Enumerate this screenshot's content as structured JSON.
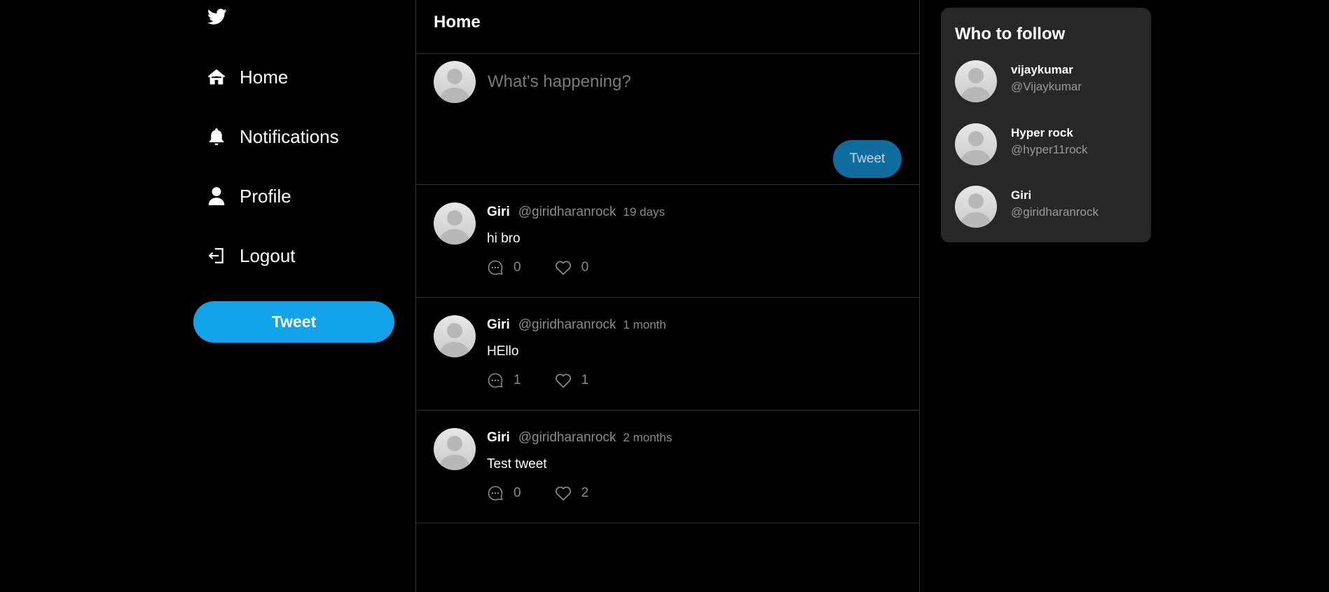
{
  "sidebar": {
    "logo_icon": "twitter-bird-icon",
    "items": [
      {
        "label": "Home",
        "icon": "home-icon"
      },
      {
        "label": "Notifications",
        "icon": "bell-icon"
      },
      {
        "label": "Profile",
        "icon": "user-icon"
      },
      {
        "label": "Logout",
        "icon": "logout-icon"
      }
    ],
    "tweet_button": "Tweet"
  },
  "main": {
    "title": "Home",
    "compose": {
      "placeholder": "What's happening?",
      "tweet_button": "Tweet"
    },
    "tweets": [
      {
        "name": "Giri",
        "handle": "@giridharanrock",
        "time": "19 days",
        "text": "hi bro",
        "replies": "0",
        "likes": "0"
      },
      {
        "name": "Giri",
        "handle": "@giridharanrock",
        "time": "1 month",
        "text": "HEllo",
        "replies": "1",
        "likes": "1"
      },
      {
        "name": "Giri",
        "handle": "@giridharanrock",
        "time": "2 months",
        "text": "Test tweet",
        "replies": "0",
        "likes": "2"
      }
    ]
  },
  "who_to_follow": {
    "title": "Who to follow",
    "users": [
      {
        "name": "vijaykumar",
        "handle": "@Vijaykumar"
      },
      {
        "name": "Hyper rock",
        "handle": "@hyper11rock"
      },
      {
        "name": "Giri",
        "handle": "@giridharanrock"
      }
    ]
  },
  "colors": {
    "background": "#000000",
    "accent": "#12a3e8",
    "accent_dim": "#0e6c9e",
    "panel": "#272727",
    "muted_text": "#8b8b8b",
    "divider": "#2f3336"
  }
}
